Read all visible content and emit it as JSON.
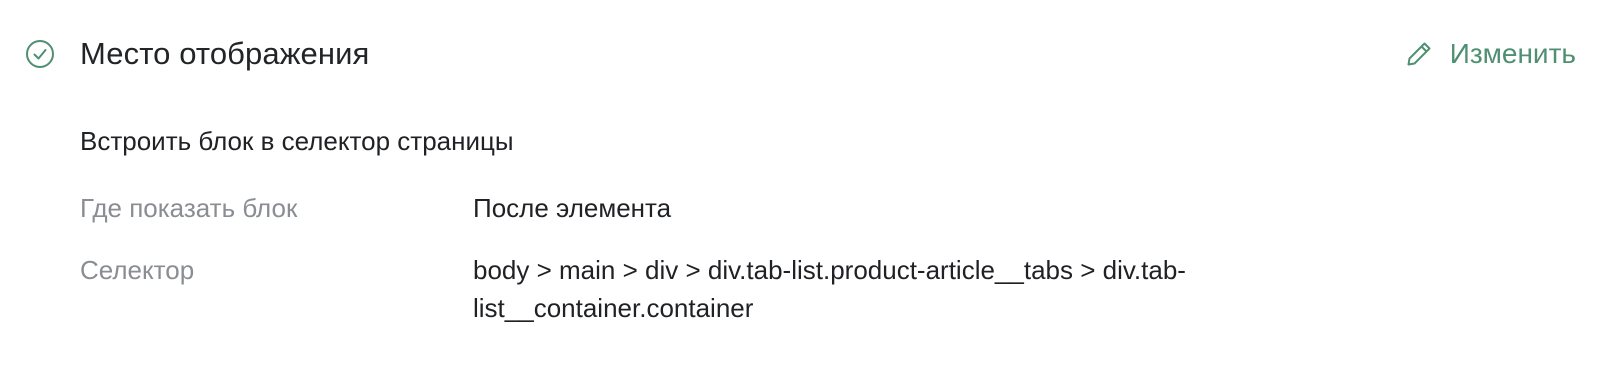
{
  "section": {
    "title": "Место отображения",
    "status_icon": "check-circle-icon",
    "edit": {
      "label": "Изменить",
      "icon": "pencil-icon"
    },
    "subtitle": "Встроить блок в селектор страницы",
    "fields": [
      {
        "label": "Где показать блок",
        "value": "После элемента"
      },
      {
        "label": "Селектор",
        "value": "body > main > div > div.tab-list.product-article__tabs > div.tab-list__container.container"
      }
    ]
  },
  "colors": {
    "accent": "#4f8f72",
    "label_gray": "#8a8d91",
    "text": "#1f2124"
  }
}
